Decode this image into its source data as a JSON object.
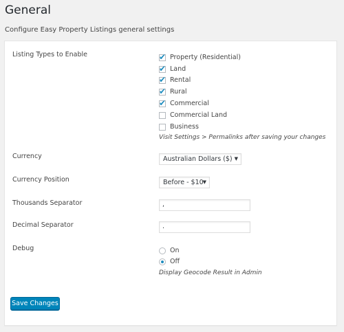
{
  "page": {
    "title": "General",
    "description": "Configure Easy Property Listings general settings"
  },
  "listing_types": {
    "label": "Listing Types to Enable",
    "options": [
      {
        "label": "Property (Residential)",
        "checked": true
      },
      {
        "label": "Land",
        "checked": true
      },
      {
        "label": "Rental",
        "checked": true
      },
      {
        "label": "Rural",
        "checked": true
      },
      {
        "label": "Commercial",
        "checked": true
      },
      {
        "label": "Commercial Land",
        "checked": false
      },
      {
        "label": "Business",
        "checked": false
      }
    ],
    "hint": "Visit Settings > Permalinks after saving your changes"
  },
  "currency": {
    "label": "Currency",
    "selected": "Australian Dollars ($)"
  },
  "currency_position": {
    "label": "Currency Position",
    "selected": "Before - $10"
  },
  "thousands_separator": {
    "label": "Thousands Separator",
    "value": ","
  },
  "decimal_separator": {
    "label": "Decimal Separator",
    "value": "."
  },
  "debug": {
    "label": "Debug",
    "options": [
      {
        "label": "On",
        "selected": false
      },
      {
        "label": "Off",
        "selected": true
      }
    ],
    "hint": "Display Geocode Result in Admin"
  },
  "actions": {
    "save_label": "Save Changes"
  },
  "colors": {
    "accent": "#0085ba",
    "checkmark": "#1e8cbe",
    "background": "#f1f1f1",
    "panel": "#ffffff"
  }
}
